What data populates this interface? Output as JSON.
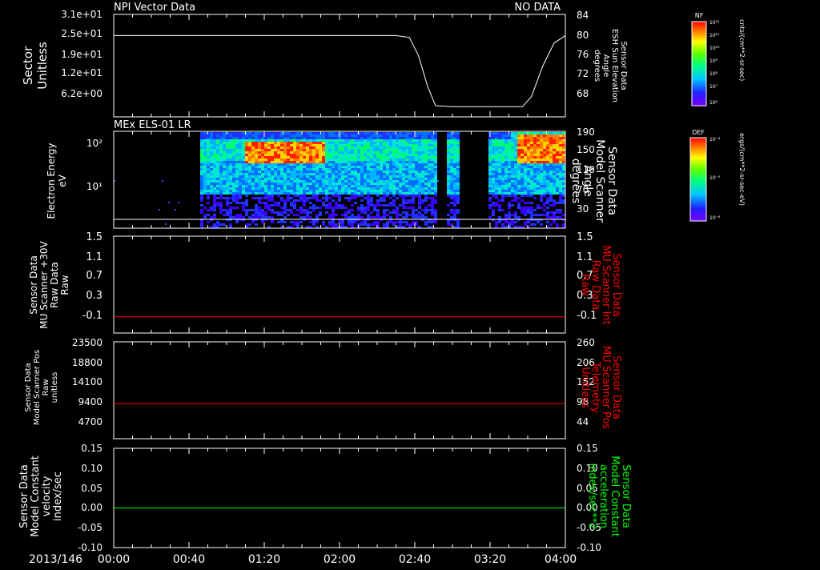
{
  "date_label": "2013/146",
  "time_ticks": [
    "00:00",
    "00:40",
    "01:20",
    "02:00",
    "02:40",
    "03:20",
    "04:00"
  ],
  "colors": {
    "axes": "#ffffff",
    "background": "#000000",
    "red_trace": "#ff0000",
    "green_trace": "#00ff00",
    "white_trace": "#ffffff"
  },
  "panels": [
    {
      "id": "sector",
      "title_left": "NPI Vector Data",
      "title_right": "NO DATA",
      "left_label": [
        "Sector",
        "Unitless"
      ],
      "left_ticks": [
        "3.1e+01",
        "2.5e+01",
        "1.9e+01",
        "1.2e+01",
        "6.2e+00"
      ],
      "right_label": [
        "Sensor Data",
        "ESH Sun Elevation",
        "Angle",
        "degrees"
      ],
      "right_label_color": "#ffffff",
      "right_ticks": [
        "84",
        "80",
        "76",
        "72",
        "68"
      ]
    },
    {
      "id": "els",
      "title_left": "MEx ELS-01 LR",
      "left_label": [
        "Electron Energy",
        "eV"
      ],
      "left_ticks": [
        "10²",
        "10¹"
      ],
      "right_label": [
        "Sensor Data",
        "Model Scanner",
        "Angle",
        "degrees"
      ],
      "right_label_color": "#ffffff",
      "right_ticks": [
        "190",
        "150",
        "110",
        "70",
        "30"
      ]
    },
    {
      "id": "mu-int",
      "left_label": [
        "Sensor Data",
        "MU Scanner +30V",
        "Raw Data",
        "Raw"
      ],
      "left_ticks": [
        "1.5",
        "1.1",
        "0.7",
        "0.3",
        "-0.1"
      ],
      "right_label": [
        "Sensor Data",
        "MU Scanner Int",
        "Raw Data",
        "Raw"
      ],
      "right_label_color": "#ff0000",
      "right_ticks": [
        "1.5",
        "1.1",
        "0.7",
        "0.3",
        "-0.1"
      ]
    },
    {
      "id": "mu-pos",
      "left_label": [
        "Sensor Data",
        "Model Scanner Pos",
        "Raw",
        "unitless"
      ],
      "left_ticks": [
        "23500",
        "18800",
        "14100",
        "9400",
        "4700"
      ],
      "right_label": [
        "Sensor Data",
        "MU Scanner Pos",
        "Telemetry",
        "Unitless"
      ],
      "right_label_color": "#ff0000",
      "right_ticks": [
        "260",
        "206",
        "152",
        "98",
        "44"
      ]
    },
    {
      "id": "model-const",
      "left_label": [
        "Sensor Data",
        "Model Constant",
        "velocity",
        "index/sec"
      ],
      "left_ticks": [
        "0.15",
        "0.10",
        "0.05",
        "0.00",
        "-0.05",
        "-0.10"
      ],
      "right_label": [
        "Sensor Data",
        "Model Constant",
        "acceleration",
        "index/sec**2"
      ],
      "right_label_color": "#00ff00",
      "right_ticks": [
        "0.15",
        "0.10",
        "0.05",
        "0.00",
        "-0.05",
        "-0.10"
      ]
    }
  ],
  "colorbars": [
    {
      "id": "nf",
      "title": "NF",
      "unit": "cnts/(cm**2-sr-sec)",
      "ticks": [
        "10¹²",
        "10¹¹",
        "10¹⁰",
        "10⁹",
        "10⁸",
        "10⁷",
        "10⁶"
      ]
    },
    {
      "id": "def",
      "title": "DEF",
      "unit": "ergs/(cm**2-sr-sec-eV)",
      "ticks": [
        "10⁻⁴",
        "10⁻⁵",
        "10⁻⁶"
      ]
    }
  ],
  "chart_data": [
    {
      "type": "line",
      "panel": "sector",
      "x_units": "hours",
      "xlim": [
        0,
        4
      ],
      "series": [
        {
          "axis": "right",
          "color": "#ffffff",
          "x": [
            0.0,
            1.0,
            2.0,
            2.5,
            2.62,
            2.7,
            2.78,
            2.85,
            3.0,
            3.4,
            3.62,
            3.7,
            3.8,
            3.9,
            4.0
          ],
          "y": [
            80,
            80,
            80,
            80,
            79.6,
            76,
            70,
            66.2,
            66,
            66,
            66,
            68,
            74,
            78.5,
            80
          ]
        }
      ],
      "ylim_right": [
        64,
        84
      ]
    },
    {
      "type": "heatmap",
      "panel": "els",
      "x_units": "hours",
      "xlim": [
        0,
        4
      ],
      "y_scale": "log",
      "ylabel": "Electron Energy",
      "data_coverage": [
        [
          0.75,
          2.85
        ],
        [
          2.95,
          3.05
        ],
        [
          3.3,
          4.0
        ]
      ],
      "intense_regions": [
        {
          "x": [
            1.15,
            1.85
          ],
          "energy_eV": [
            40,
            120
          ],
          "level": "high"
        },
        {
          "x": [
            3.55,
            4.0
          ],
          "energy_eV": [
            40,
            180
          ],
          "level": "high"
        }
      ],
      "reference_line_right": 20
    },
    {
      "type": "line",
      "panel": "mu-int",
      "xlim": [
        0,
        4
      ],
      "series": [
        {
          "color": "#ff0000",
          "x": [
            0,
            4
          ],
          "y": [
            0.0,
            0.0
          ]
        }
      ],
      "ylim": [
        -0.3,
        1.5
      ]
    },
    {
      "type": "line",
      "panel": "mu-pos",
      "xlim": [
        0,
        4
      ],
      "series": [
        {
          "color": "#ff0000",
          "x": [
            0,
            4
          ],
          "y": [
            8500,
            8500
          ]
        }
      ],
      "ylim": [
        0,
        23500
      ]
    },
    {
      "type": "line",
      "panel": "model-const",
      "xlim": [
        0,
        4
      ],
      "series": [
        {
          "color": "#00ff00",
          "x": [
            0,
            4
          ],
          "y": [
            0.0,
            0.0
          ]
        }
      ],
      "ylim": [
        -0.1,
        0.15
      ]
    }
  ]
}
